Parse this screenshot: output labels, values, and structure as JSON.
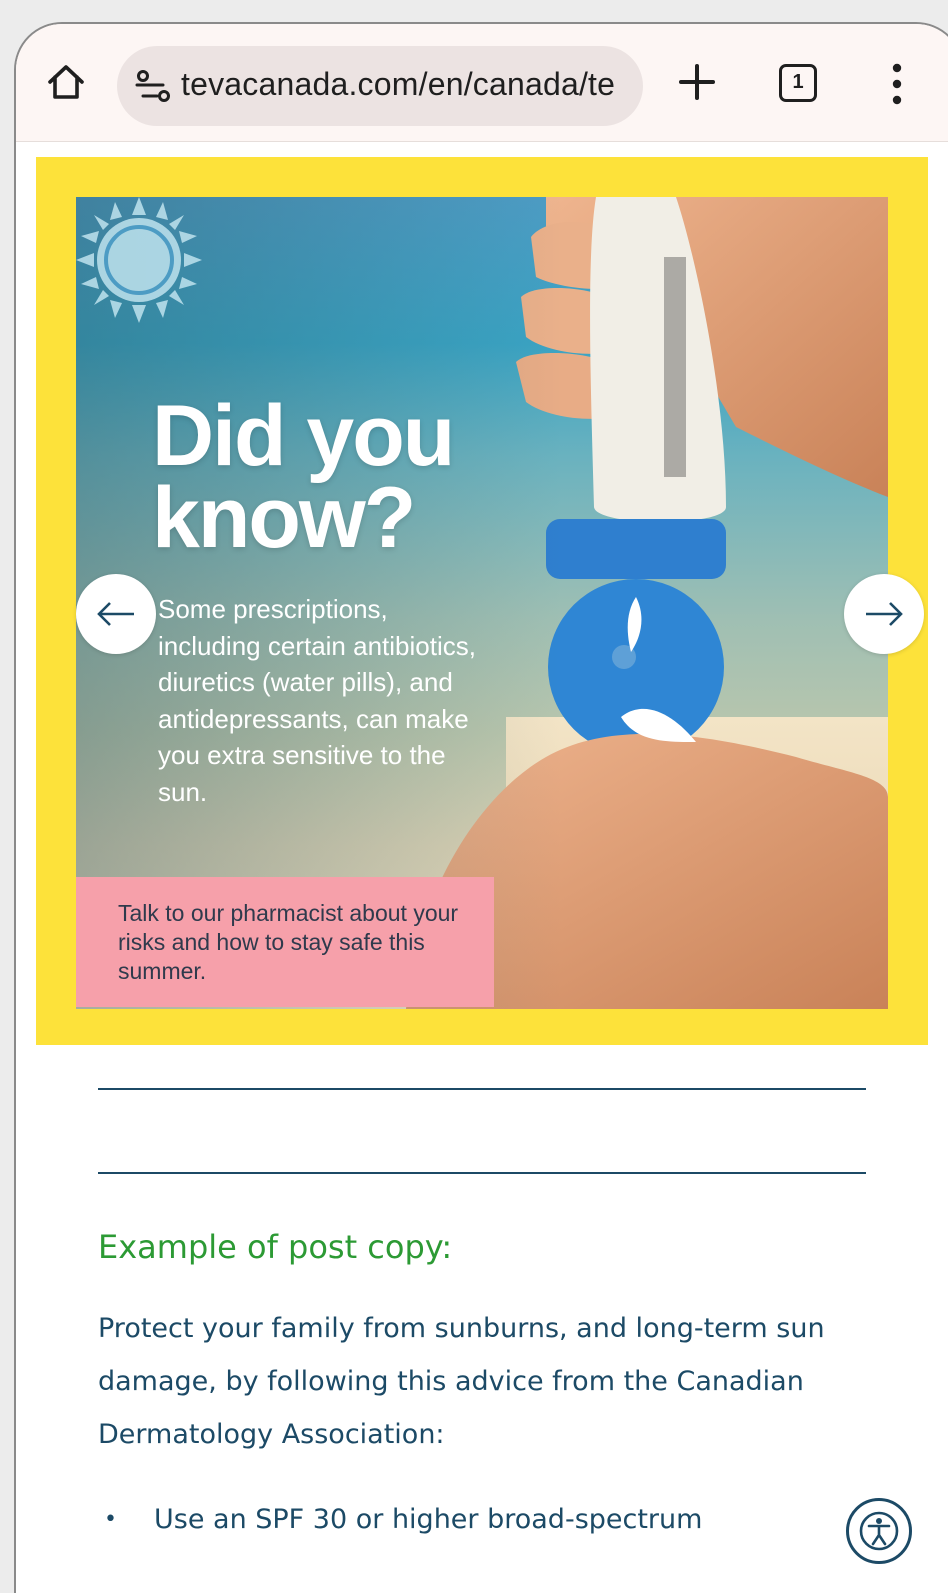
{
  "browser": {
    "url": "tevacanada.com/en/canada/te",
    "tab_count": "1",
    "icons": {
      "home": "home-icon",
      "site_info": "site-info-tune-icon",
      "new_tab": "plus-icon",
      "tabs": "tab-switcher-icon",
      "menu": "more-vertical-icon"
    }
  },
  "carousel": {
    "headline_line1": "Did you",
    "headline_line2": "know?",
    "body": "Some prescriptions, including certain antibiotics, diuretics (water pills), and antidepressants, can make you extra sensitive to the sun.",
    "callout": "Talk to our pharmacist about your risks and how to stay safe this summer.",
    "prev_arrow": "←",
    "next_arrow": "→",
    "colors": {
      "frame": "#fde23a",
      "callout_bg": "#f6a0aa"
    }
  },
  "post": {
    "heading": "Example of post copy:",
    "intro": "Protect your family from sunburns, and long-term sun damage, by following this advice from the Canadian Dermatology Association:",
    "bullets": [
      "Use an SPF 30 or higher broad-spectrum"
    ]
  },
  "colors": {
    "heading_green": "#2c9a34",
    "text_navy": "#1c4a66"
  }
}
